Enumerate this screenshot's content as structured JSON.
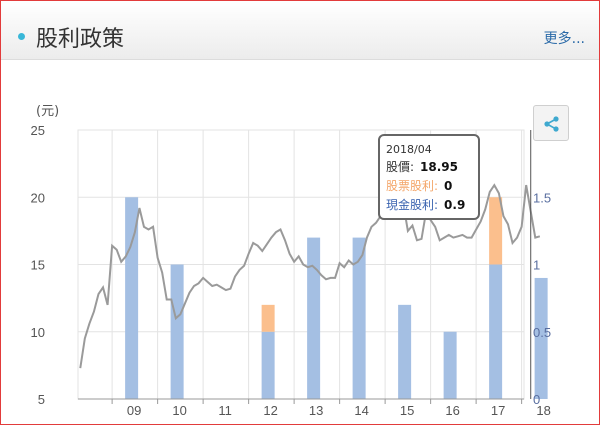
{
  "header": {
    "title": "股利政策",
    "more_label": "更多..."
  },
  "colors": {
    "price_line": "#9a9a9a",
    "stock_dividend": "#fbbf8d",
    "cash_dividend": "#a4bfe3",
    "accent": "#39b7d8",
    "link": "#2a6aa8"
  },
  "icons": {
    "share": "share-icon"
  },
  "tooltip": {
    "date": "2018/04",
    "price_label": "股價:",
    "price_value": "18.95",
    "stock_label": "股票股利:",
    "stock_value": "0",
    "cash_label": "現金股利:",
    "cash_value": "0.9"
  },
  "chart_data": {
    "type": "line+bar",
    "x_tick_labels": [
      "09",
      "10",
      "11",
      "12",
      "13",
      "14",
      "15",
      "16",
      "17",
      "18"
    ],
    "y_left": {
      "label": "(元)",
      "ticks": [
        "5",
        "10",
        "15",
        "20",
        "25"
      ],
      "range": [
        5,
        25
      ]
    },
    "y_right": {
      "ticks": [
        "0",
        "0.5",
        "1",
        "1.5"
      ],
      "range": [
        0,
        2
      ]
    },
    "grid": true,
    "price_series": {
      "x": [
        2008.3,
        2008.4,
        2008.5,
        2008.6,
        2008.7,
        2008.8,
        2008.9,
        2009.0,
        2009.1,
        2009.2,
        2009.3,
        2009.4,
        2009.5,
        2009.6,
        2009.7,
        2009.8,
        2009.9,
        2010.0,
        2010.1,
        2010.2,
        2010.3,
        2010.4,
        2010.5,
        2010.6,
        2010.7,
        2010.8,
        2010.9,
        2011.0,
        2011.1,
        2011.2,
        2011.3,
        2011.4,
        2011.5,
        2011.6,
        2011.7,
        2011.8,
        2011.9,
        2012.0,
        2012.1,
        2012.2,
        2012.3,
        2012.4,
        2012.5,
        2012.6,
        2012.7,
        2012.8,
        2012.9,
        2013.0,
        2013.1,
        2013.2,
        2013.3,
        2013.4,
        2013.5,
        2013.6,
        2013.7,
        2013.8,
        2013.9,
        2014.0,
        2014.1,
        2014.2,
        2014.3,
        2014.4,
        2014.5,
        2014.6,
        2014.7,
        2014.8,
        2014.9,
        2015.0,
        2015.1,
        2015.2,
        2015.3,
        2015.4,
        2015.5,
        2015.6,
        2015.7,
        2015.8,
        2015.9,
        2016.0,
        2016.1,
        2016.2,
        2016.3,
        2016.4,
        2016.5,
        2016.6,
        2016.7,
        2016.8,
        2016.9,
        2017.0,
        2017.1,
        2017.2,
        2017.3,
        2017.4,
        2017.5,
        2017.6,
        2017.7,
        2017.8,
        2017.9,
        2018.0,
        2018.1,
        2018.2,
        2018.3,
        2018.4
      ],
      "values": [
        7.3,
        9.5,
        10.6,
        11.5,
        12.8,
        13.3,
        12.0,
        16.4,
        16.1,
        15.2,
        15.6,
        16.3,
        17.4,
        19.2,
        17.8,
        17.6,
        17.8,
        15.5,
        14.4,
        12.4,
        12.4,
        11.0,
        11.3,
        12.1,
        12.9,
        13.4,
        13.6,
        14.0,
        13.7,
        13.4,
        13.5,
        13.3,
        13.1,
        13.2,
        14.1,
        14.6,
        14.9,
        15.8,
        16.6,
        16.4,
        16.0,
        16.5,
        17.0,
        17.4,
        17.6,
        16.8,
        15.8,
        15.2,
        15.6,
        15.0,
        14.8,
        14.9,
        14.6,
        14.2,
        13.9,
        14.0,
        14.0,
        15.1,
        14.8,
        15.3,
        15.0,
        15.2,
        15.7,
        17.0,
        17.8,
        18.1,
        18.6,
        18.9,
        19.5,
        20.9,
        20.8,
        19.5,
        17.5,
        17.9,
        16.8,
        16.9,
        18.9,
        18.3,
        17.8,
        16.8,
        17.0,
        17.2,
        17.0,
        17.1,
        17.2,
        17.0,
        17.0,
        17.6,
        18.2,
        19.1,
        20.4,
        20.9,
        20.3,
        18.6,
        18.0,
        16.6,
        17.0,
        17.8,
        20.9,
        18.95,
        17.0,
        17.1
      ]
    },
    "cash_dividend_series": {
      "x": [
        "09",
        "10",
        "12",
        "13",
        "14",
        "15",
        "16",
        "17",
        "18"
      ],
      "values": [
        1.5,
        1.0,
        0.5,
        1.2,
        1.2,
        0.7,
        0.5,
        1.0,
        0.9
      ]
    },
    "stock_dividend_series": {
      "x": [
        "09",
        "10",
        "12",
        "13",
        "14",
        "15",
        "16",
        "17",
        "18"
      ],
      "values": [
        0,
        0,
        0.2,
        0,
        0,
        0,
        0,
        0.5,
        0
      ]
    }
  }
}
